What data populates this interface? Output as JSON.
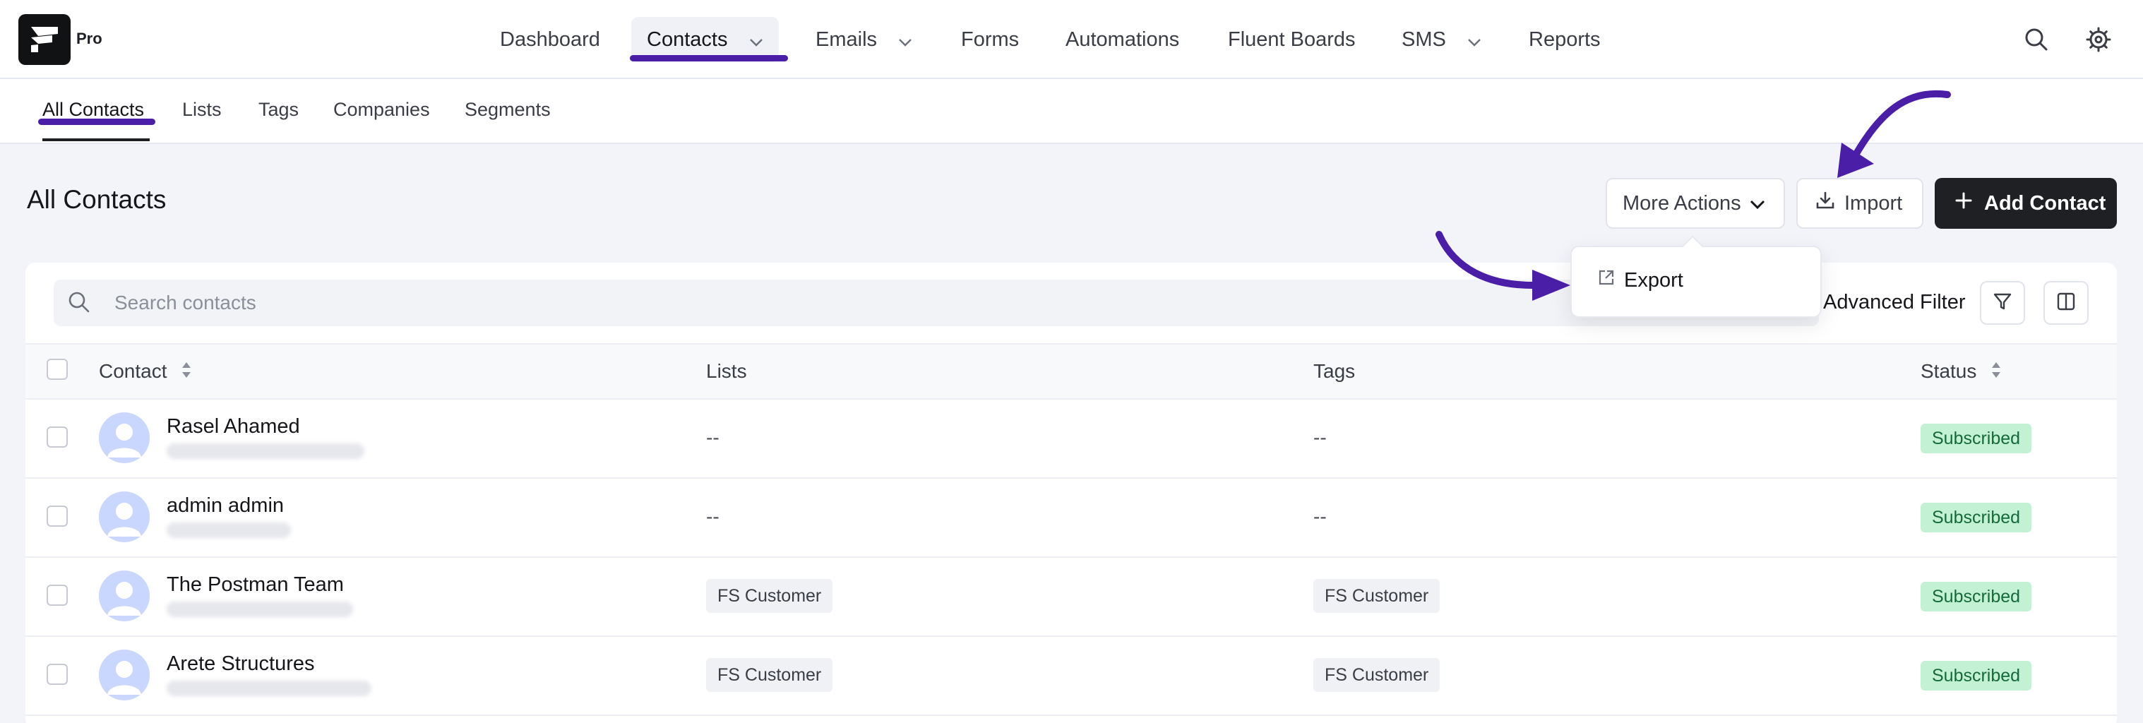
{
  "brand": {
    "badge": "Pro"
  },
  "nav": {
    "items": [
      {
        "label": "Dashboard"
      },
      {
        "label": "Contacts"
      },
      {
        "label": "Emails"
      },
      {
        "label": "Forms"
      },
      {
        "label": "Automations"
      },
      {
        "label": "Fluent Boards"
      },
      {
        "label": "SMS"
      },
      {
        "label": "Reports"
      }
    ],
    "active": "Contacts"
  },
  "subnav": {
    "items": [
      {
        "label": "All Contacts"
      },
      {
        "label": "Lists"
      },
      {
        "label": "Tags"
      },
      {
        "label": "Companies"
      },
      {
        "label": "Segments"
      }
    ]
  },
  "page": {
    "title": "All Contacts",
    "more_actions_label": "More Actions",
    "import_label": "Import",
    "add_contact_label": "Add Contact"
  },
  "dropdown": {
    "export_label": "Export"
  },
  "search": {
    "placeholder": "Search contacts"
  },
  "filters": {
    "advanced_filter_label": "Advanced Filter"
  },
  "table": {
    "columns": [
      "Contact",
      "Lists",
      "Tags",
      "Status"
    ],
    "rows": [
      {
        "name": "Rasel Ahamed",
        "lists": "--",
        "tags": "--",
        "status": "Subscribed"
      },
      {
        "name": "admin admin",
        "lists": "--",
        "tags": "--",
        "status": "Subscribed"
      },
      {
        "name": "The Postman Team",
        "lists": "FS Customer",
        "tags": "FS Customer",
        "status": "Subscribed"
      },
      {
        "name": "Arete Structures",
        "lists": "FS Customer",
        "tags": "FS Customer",
        "status": "Subscribed"
      }
    ]
  },
  "colors": {
    "accent": "#4b1ea8",
    "primary_button": "#1f2024",
    "status_subscribed_bg": "#c3f1d4",
    "status_subscribed_text": "#166a3a",
    "avatar_bg": "#c9d7ff"
  },
  "icons": {
    "search": "search-icon",
    "settings": "gear-icon",
    "import": "download-icon",
    "add": "plus-icon",
    "export": "export-icon",
    "filter": "filter-icon",
    "columns": "columns-icon"
  }
}
